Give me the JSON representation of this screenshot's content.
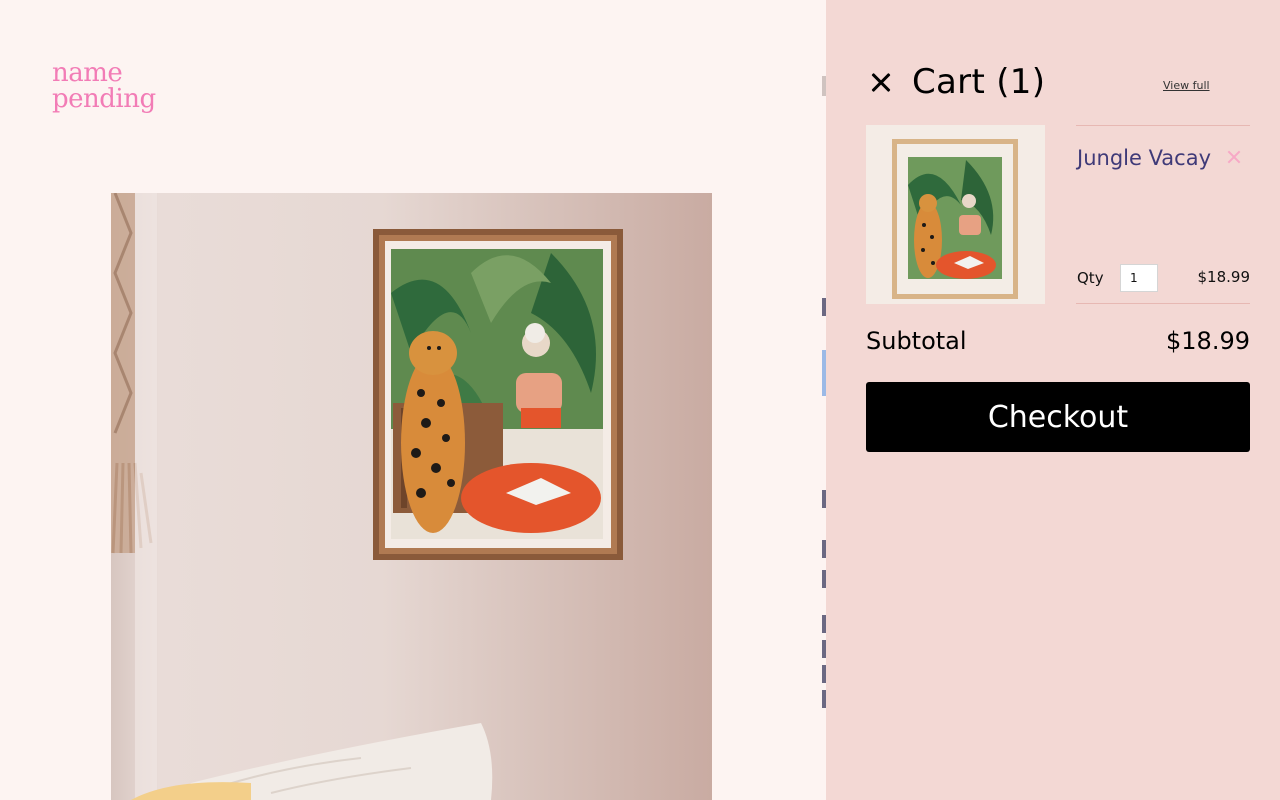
{
  "brand": {
    "line1": "name",
    "line2": "pending",
    "color": "#f27cb6"
  },
  "cart": {
    "title": "Cart (1)",
    "view_full_label": "View full",
    "close_icon": "close-icon",
    "items": [
      {
        "name": "Jungle Vacay",
        "qty_label": "Qty",
        "qty": "1",
        "price": "$18.99",
        "remove_icon": "close-icon"
      }
    ],
    "subtotal_label": "Subtotal",
    "subtotal_value": "$18.99",
    "checkout_label": "Checkout"
  },
  "colors": {
    "drawer_bg": "#f3d8d4",
    "page_bg": "#fdf4f2",
    "item_name": "#3f3a78",
    "remove": "#f7a8c6",
    "checkout_bg": "#000000"
  }
}
